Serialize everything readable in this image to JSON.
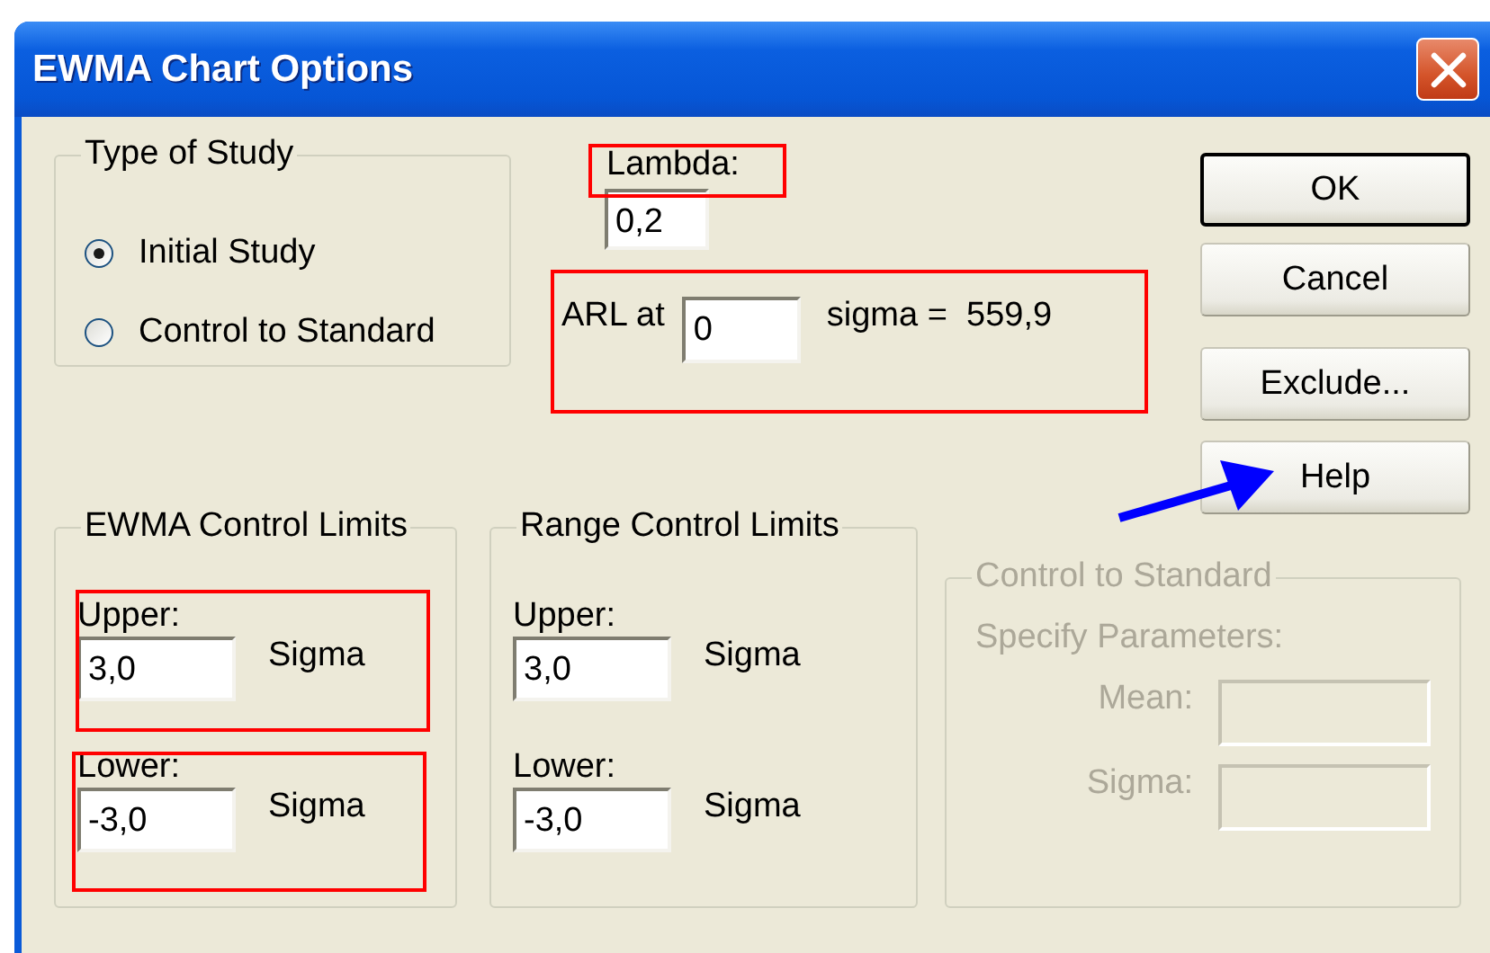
{
  "window": {
    "title": "EWMA Chart Options"
  },
  "type_of_study": {
    "label": "Type of Study",
    "options": [
      {
        "label": "Initial Study",
        "selected": true
      },
      {
        "label": "Control to Standard",
        "selected": false
      }
    ]
  },
  "lambda": {
    "label": "Lambda:",
    "value": "0,2"
  },
  "arl": {
    "label": "ARL at",
    "value": "0",
    "result": "sigma =  559,9"
  },
  "buttons": [
    {
      "label": "OK",
      "default": true
    },
    {
      "label": "Cancel",
      "default": false
    },
    {
      "label": "Exclude...",
      "default": false
    },
    {
      "label": "Help",
      "default": false
    }
  ],
  "limit_groups": [
    {
      "label": "EWMA Control Limits",
      "fields": [
        {
          "label": "Upper:",
          "value": "3,0",
          "unit": "Sigma"
        },
        {
          "label": "Lower:",
          "value": "-3,0",
          "unit": "Sigma"
        }
      ]
    },
    {
      "label": "Range Control Limits",
      "fields": [
        {
          "label": "Upper:",
          "value": "3,0",
          "unit": "Sigma"
        },
        {
          "label": "Lower:",
          "value": "-3,0",
          "unit": "Sigma"
        }
      ]
    }
  ],
  "control_to_standard": {
    "label": "Control to Standard",
    "disabled": true,
    "subtitle": "Specify Parameters:",
    "fields": [
      {
        "label": "Mean:"
      },
      {
        "label": "Sigma:"
      }
    ]
  }
}
